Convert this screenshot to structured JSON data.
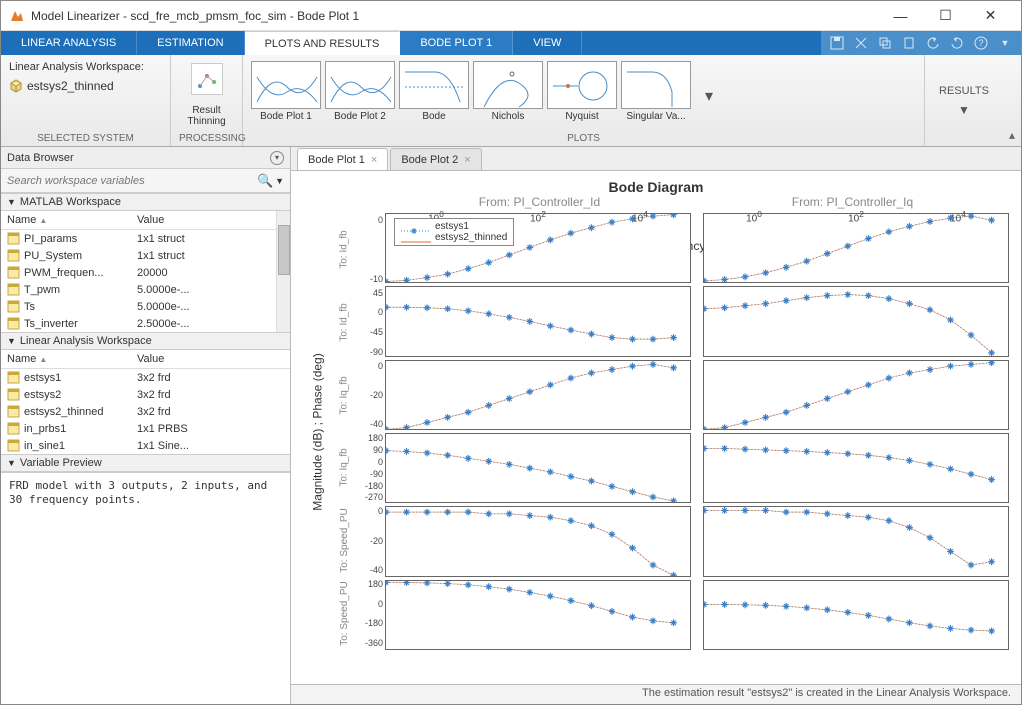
{
  "window": {
    "title": "Model Linearizer - scd_fre_mcb_pmsm_foc_sim - Bode Plot 1"
  },
  "ribbon_tabs": [
    "LINEAR ANALYSIS",
    "ESTIMATION",
    "PLOTS AND RESULTS",
    "BODE PLOT 1",
    "VIEW"
  ],
  "ribbon_active": 2,
  "selected_system": {
    "title": "Linear Analysis Workspace:",
    "item": "estsys2_thinned",
    "group_label": "SELECTED SYSTEM"
  },
  "processing": {
    "button": "Result Thinning",
    "group_label": "PROCESSING"
  },
  "plots_group": {
    "group_label": "PLOTS",
    "items": [
      "Bode Plot 1",
      "Bode Plot 2",
      "Bode",
      "Nichols",
      "Nyquist",
      "Singular Va..."
    ]
  },
  "results_btn": "RESULTS",
  "data_browser": {
    "title": "Data Browser",
    "search_placeholder": "Search workspace variables"
  },
  "matlab_ws": {
    "title": "MATLAB Workspace",
    "cols": [
      "Name",
      "Value"
    ],
    "rows": [
      {
        "name": "PI_params",
        "value": "1x1 struct"
      },
      {
        "name": "PU_System",
        "value": "1x1 struct"
      },
      {
        "name": "PWM_frequen...",
        "value": "20000"
      },
      {
        "name": "T_pwm",
        "value": "5.0000e-..."
      },
      {
        "name": "Ts",
        "value": "5.0000e-..."
      },
      {
        "name": "Ts_inverter",
        "value": "2.5000e-..."
      }
    ]
  },
  "la_ws": {
    "title": "Linear Analysis Workspace",
    "cols": [
      "Name",
      "Value"
    ],
    "rows": [
      {
        "name": "estsys1",
        "value": "3x2 frd"
      },
      {
        "name": "estsys2",
        "value": "3x2 frd"
      },
      {
        "name": "estsys2_thinned",
        "value": "3x2 frd"
      },
      {
        "name": "in_prbs1",
        "value": "1x1 PRBS"
      },
      {
        "name": "in_sine1",
        "value": "1x1 Sine..."
      }
    ]
  },
  "var_preview": {
    "title": "Variable Preview",
    "text": "FRD model with 3 outputs, 2 inputs, and 30 frequency points."
  },
  "plot_tabs": [
    {
      "label": "Bode Plot 1",
      "active": true
    },
    {
      "label": "Bode Plot 2",
      "active": false
    }
  ],
  "statusbar": "The estimation result \"estsys2\" is created in the Linear Analysis Workspace.",
  "chart_data": {
    "type": "bode",
    "title": "Bode Diagram",
    "xlabel": "Frequency  (rad/s)",
    "ylabel": "Magnitude (dB) ; Phase (deg)",
    "x_scale": "log",
    "x_ticks": [
      1,
      100,
      10000
    ],
    "x_tick_labels": [
      "10^0",
      "10^2",
      "10^4"
    ],
    "inputs": [
      "From: PI_Controller_Id",
      "From: PI_Controller_Iq"
    ],
    "outputs_rows": [
      "To: Id_fb",
      "To: Id_fb",
      "To: Iq_fb",
      "To: Iq_fb",
      "To: Speed_PU",
      "To: Speed_PU"
    ],
    "legend": [
      "estsys1",
      "estsys2_thinned"
    ],
    "legend_colors": [
      "#3a7fc9",
      "#e07030"
    ],
    "x_values_log10": [
      0,
      0.25,
      0.5,
      0.75,
      1.0,
      1.25,
      1.5,
      1.75,
      2.0,
      2.25,
      2.5,
      2.75,
      3.0,
      3.25,
      3.5
    ],
    "panels": [
      {
        "row": 0,
        "col": 0,
        "ylim": [
          -10,
          0
        ],
        "yticks": [
          0,
          -10
        ],
        "y_est": [
          -9.9,
          -9.7,
          -9.3,
          -8.8,
          -8.0,
          -7.1,
          -6.0,
          -4.9,
          -3.8,
          -2.8,
          -2.0,
          -1.2,
          -0.7,
          -0.3,
          -0.1
        ]
      },
      {
        "row": 0,
        "col": 1,
        "ylim": [
          -10,
          0
        ],
        "yticks": [
          0,
          -10
        ],
        "y_est": [
          -9.8,
          -9.6,
          -9.2,
          -8.6,
          -7.8,
          -6.9,
          -5.8,
          -4.7,
          -3.6,
          -2.6,
          -1.8,
          -1.1,
          -0.6,
          -0.3,
          -0.9
        ]
      },
      {
        "row": 1,
        "col": 0,
        "ylim": [
          -90,
          45
        ],
        "yticks": [
          45,
          0,
          -45,
          -90
        ],
        "y_est": [
          5,
          5,
          4,
          2,
          -2,
          -8,
          -15,
          -23,
          -32,
          -40,
          -48,
          -55,
          -58,
          -58,
          -55
        ]
      },
      {
        "row": 1,
        "col": 1,
        "ylim": [
          -90,
          45
        ],
        "yticks": [
          45,
          0,
          -45,
          -90
        ],
        "y_est": [
          2,
          4,
          8,
          12,
          18,
          24,
          28,
          30,
          28,
          22,
          12,
          0,
          -20,
          -50,
          -85
        ]
      },
      {
        "row": 2,
        "col": 0,
        "ylim": [
          -40,
          0
        ],
        "yticks": [
          0,
          -20,
          -40
        ],
        "y_est": [
          -40,
          -39,
          -36,
          -33,
          -30,
          -26,
          -22,
          -18,
          -14,
          -10,
          -7,
          -5,
          -3,
          -2,
          -4
        ]
      },
      {
        "row": 2,
        "col": 1,
        "ylim": [
          -40,
          0
        ],
        "yticks": [
          0,
          -20,
          -40
        ],
        "y_est": [
          -40,
          -39,
          -36,
          -33,
          -30,
          -26,
          -22,
          -18,
          -14,
          -10,
          -7,
          -5,
          -3,
          -2,
          -1
        ]
      },
      {
        "row": 3,
        "col": 0,
        "ylim": [
          -270,
          180
        ],
        "yticks": [
          180,
          90,
          0,
          -90,
          -180,
          -270
        ],
        "y_est": [
          70,
          65,
          55,
          40,
          20,
          0,
          -20,
          -45,
          -70,
          -100,
          -130,
          -165,
          -200,
          -235,
          -260
        ]
      },
      {
        "row": 3,
        "col": 1,
        "ylim": [
          -270,
          180
        ],
        "yticks": [
          180,
          90,
          0,
          -90,
          -180,
          -270
        ],
        "y_est": [
          85,
          85,
          80,
          75,
          70,
          65,
          58,
          50,
          40,
          25,
          5,
          -20,
          -50,
          -85,
          -120
        ]
      },
      {
        "row": 4,
        "col": 0,
        "ylim": [
          -40,
          0
        ],
        "yticks": [
          0,
          -20,
          -40
        ],
        "y_est": [
          -3,
          -3,
          -3,
          -3,
          -3,
          -4,
          -4,
          -5,
          -6,
          -8,
          -11,
          -16,
          -24,
          -34,
          -40
        ]
      },
      {
        "row": 4,
        "col": 1,
        "ylim": [
          -40,
          0
        ],
        "yticks": [
          0,
          -20,
          -40
        ],
        "y_est": [
          -2,
          -2,
          -2,
          -2,
          -3,
          -3,
          -4,
          -5,
          -6,
          -8,
          -12,
          -18,
          -26,
          -34,
          -32
        ]
      },
      {
        "row": 5,
        "col": 0,
        "ylim": [
          -360,
          180
        ],
        "yticks": [
          180,
          0,
          -180,
          -360
        ],
        "y_est": [
          170,
          168,
          165,
          160,
          150,
          135,
          115,
          90,
          60,
          25,
          -15,
          -60,
          -105,
          -135,
          -150
        ]
      },
      {
        "row": 5,
        "col": 1,
        "ylim": [
          -360,
          180
        ],
        "yticks": [
          180,
          0,
          -180,
          -360
        ],
        "y_est": [
          -5,
          -5,
          -8,
          -12,
          -20,
          -32,
          -48,
          -68,
          -92,
          -120,
          -150,
          -175,
          -195,
          -208,
          -215
        ]
      }
    ]
  }
}
